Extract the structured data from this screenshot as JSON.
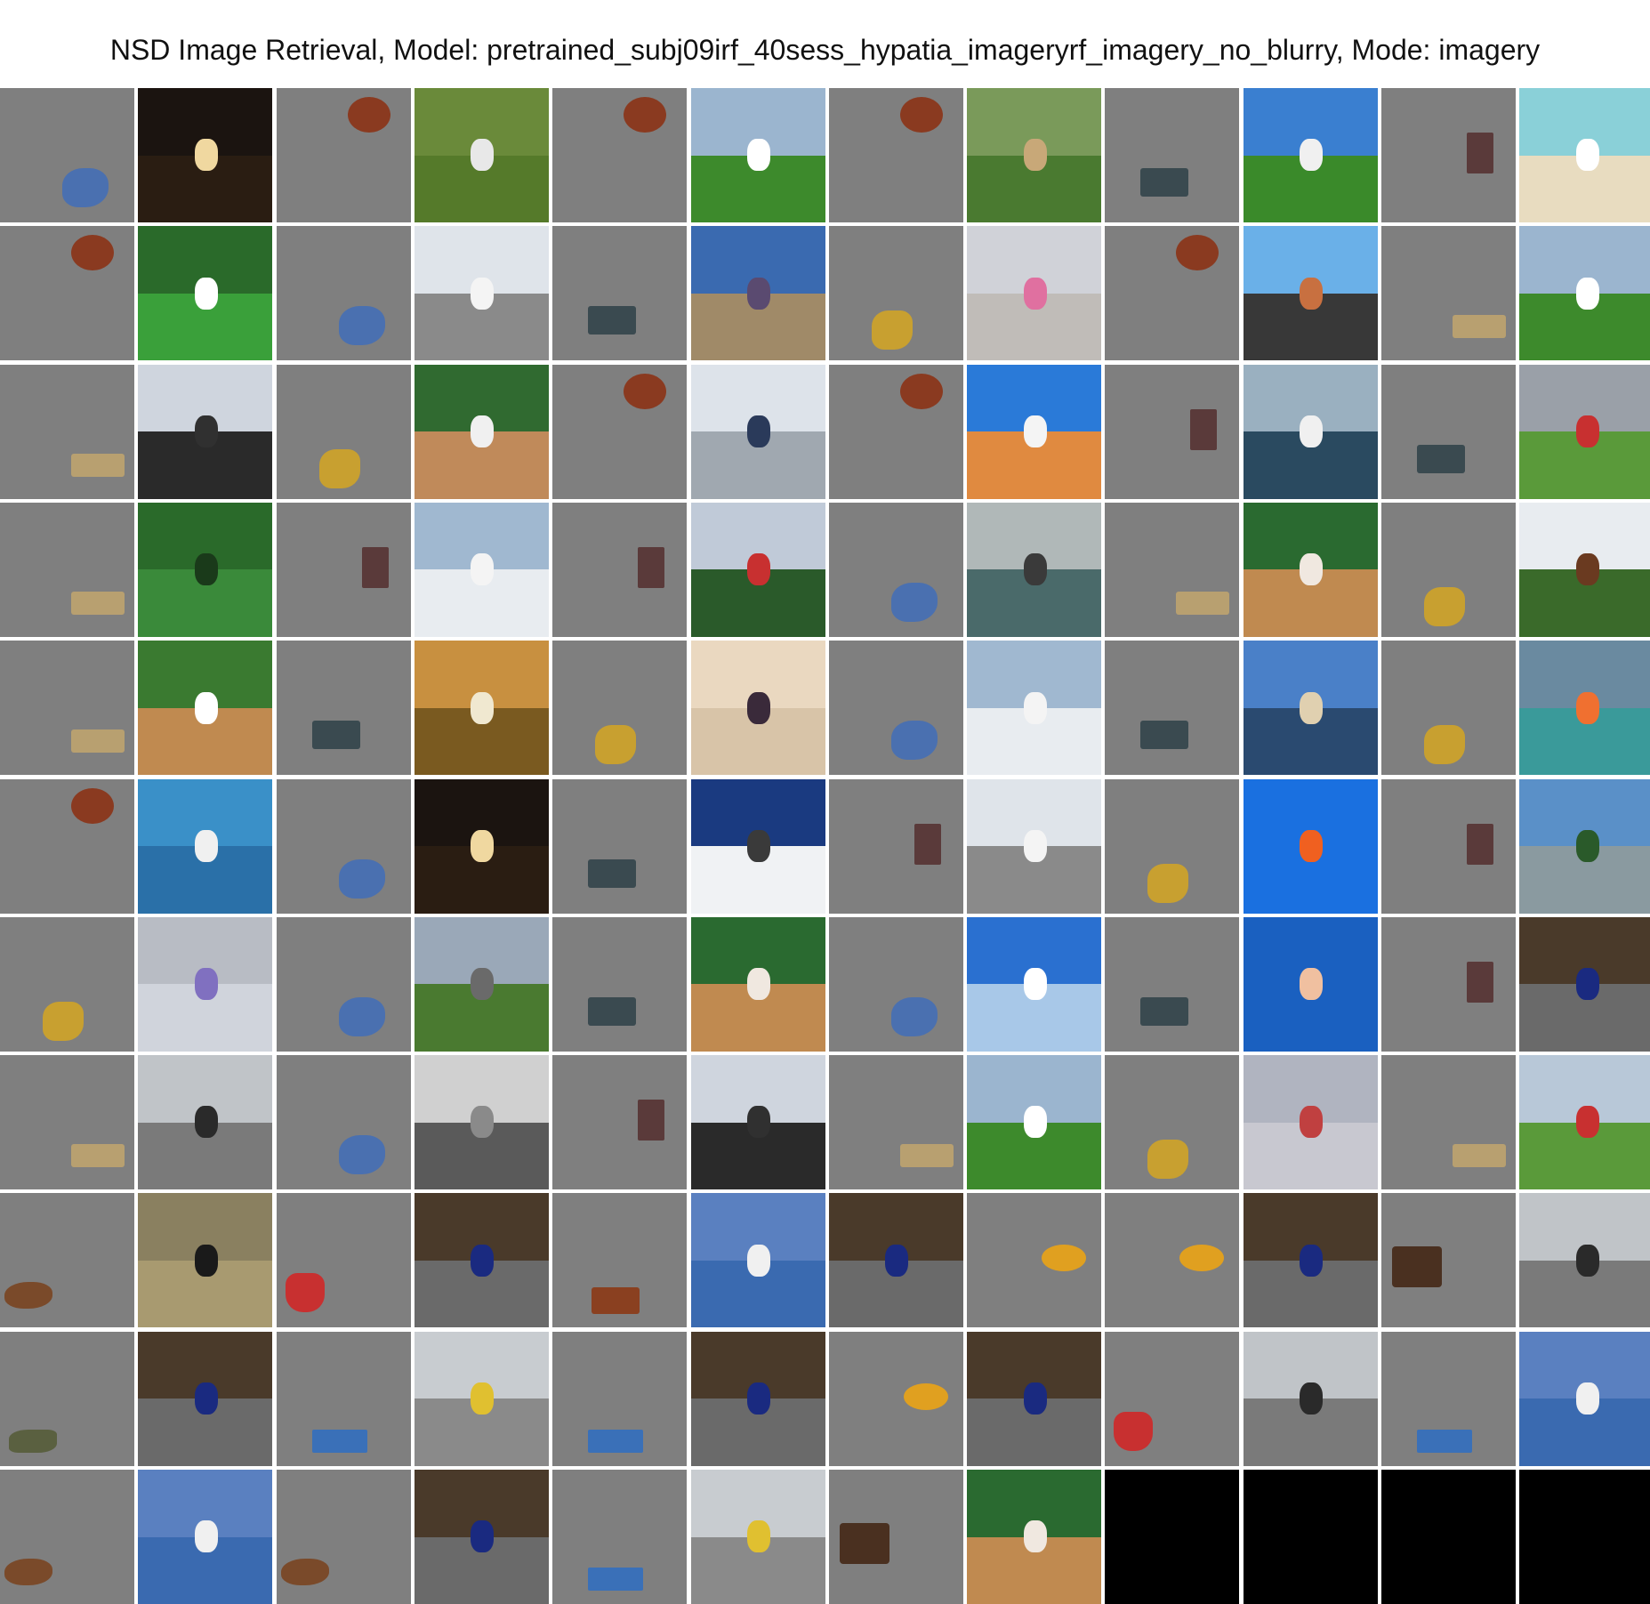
{
  "title": "NSD Image Retrieval, Model: pretrained_subj09irf_40sess_hypatia_imageryrf_imagery_no_blurry, Mode: imagery",
  "grid": {
    "rows": 12,
    "cols": 12,
    "cells": [
      [
        "stimulus-blue-blob",
        "photo-night-church-spire",
        "stimulus-baby-face",
        "photo-baseball-batter",
        "stimulus-baby-face",
        "photo-frisbee-field",
        "stimulus-baby-face",
        "photo-pony-waterfall",
        "stimulus-crowd-photo",
        "photo-kites-beach-house",
        "stimulus-dark-building",
        "photo-beach-plane"
      ],
      [
        "stimulus-baby-face",
        "photo-lacrosse-feet",
        "stimulus-blue-blob",
        "photo-small-airplane",
        "stimulus-crowd-photo",
        "photo-skatepark-bowl",
        "stimulus-gold-dragon",
        "photo-kite-flying",
        "stimulus-baby-face",
        "photo-skateboard-ramp",
        "stimulus-wood-plank",
        "photo-frisbee-field"
      ],
      [
        "stimulus-wood-plank",
        "photo-flag-statue",
        "stimulus-gold-dragon",
        "photo-baseball-swing",
        "stimulus-baby-face",
        "photo-skier-jump",
        "stimulus-baby-face",
        "photo-skateboard-jump",
        "stimulus-dark-building",
        "photo-lighthouse-boat",
        "stimulus-crowd-photo",
        "photo-kids-soccer"
      ],
      [
        "stimulus-wood-plank",
        "photo-baseball-suzuki",
        "stimulus-dark-building",
        "photo-seaplane-clouds",
        "stimulus-dark-building",
        "photo-jet-flag",
        "stimulus-blue-blob",
        "photo-elephant-river",
        "stimulus-wood-plank",
        "photo-baseball-catcher",
        "stimulus-gold-dragon",
        "photo-horses-field"
      ],
      [
        "stimulus-wood-plank",
        "photo-baseball-hit",
        "stimulus-crowd-photo",
        "photo-gym-acrobat",
        "stimulus-gold-dragon",
        "photo-toothbrush",
        "stimulus-blue-blob",
        "photo-seaplane-clouds",
        "stimulus-crowd-photo",
        "photo-city-river",
        "stimulus-gold-dragon",
        "photo-yogurt-carrots"
      ],
      [
        "stimulus-baby-face",
        "photo-tennis-player",
        "stimulus-blue-blob",
        "photo-night-church-spire",
        "stimulus-crowd-photo",
        "photo-snow-skier",
        "stimulus-dark-building",
        "photo-small-airplane",
        "stimulus-gold-dragon",
        "photo-orange-berries",
        "stimulus-dark-building",
        "photo-mountain-road"
      ],
      [
        "stimulus-gold-dragon",
        "photo-phone-napkin",
        "stimulus-blue-blob",
        "photo-country-road",
        "stimulus-crowd-photo",
        "photo-baseball-catcher",
        "stimulus-blue-blob",
        "photo-jet-blue-sky",
        "stimulus-crowd-photo",
        "photo-ski-jumper",
        "stimulus-dark-building",
        "photo-banana-bowl"
      ],
      [
        "stimulus-wood-plank",
        "photo-skateboarders",
        "stimulus-blue-blob",
        "photo-clock-tower",
        "stimulus-dark-building",
        "photo-flag-statue",
        "stimulus-wood-plank",
        "photo-frisbee-field",
        "stimulus-gold-dragon",
        "photo-jet-clouds",
        "stimulus-wood-plank",
        "photo-fire-hydrant"
      ],
      [
        "stimulus-walrus",
        "photo-zebra",
        "stimulus-red-garment",
        "photo-banana-bowl",
        "stimulus-brick-wall",
        "photo-snow-mountain-lake",
        "photo-banana-bowl",
        "stimulus-yellow-pieces",
        "photo-banana-bowl",
        "stimulus-smiling-people",
        "photo-skateboarders"
      ],
      [
        "stimulus-crocodile",
        "photo-banana-bowl",
        "stimulus-blue-sky-strip",
        "photo-skate-bowl-rider",
        "stimulus-blue-sky-strip",
        "photo-banana-bowl",
        "stimulus-yellow-pieces",
        "photo-banana-bowl",
        "stimulus-red-garment",
        "photo-skateboarders",
        "stimulus-blue-sky-strip",
        "photo-snow-mountain-lake"
      ],
      [
        "stimulus-walrus",
        "photo-snow-mountain-lake",
        "stimulus-walrus",
        "photo-banana-bowl",
        "stimulus-blue-sky-strip",
        "photo-skate-bowl-rider",
        "stimulus-smiling-people",
        "photo-baseball-catcher",
        "empty",
        "empty",
        "empty",
        "empty"
      ]
    ]
  },
  "palette": {
    "gray": "#7f7f7f",
    "black": "#000000",
    "white": "#ffffff"
  }
}
